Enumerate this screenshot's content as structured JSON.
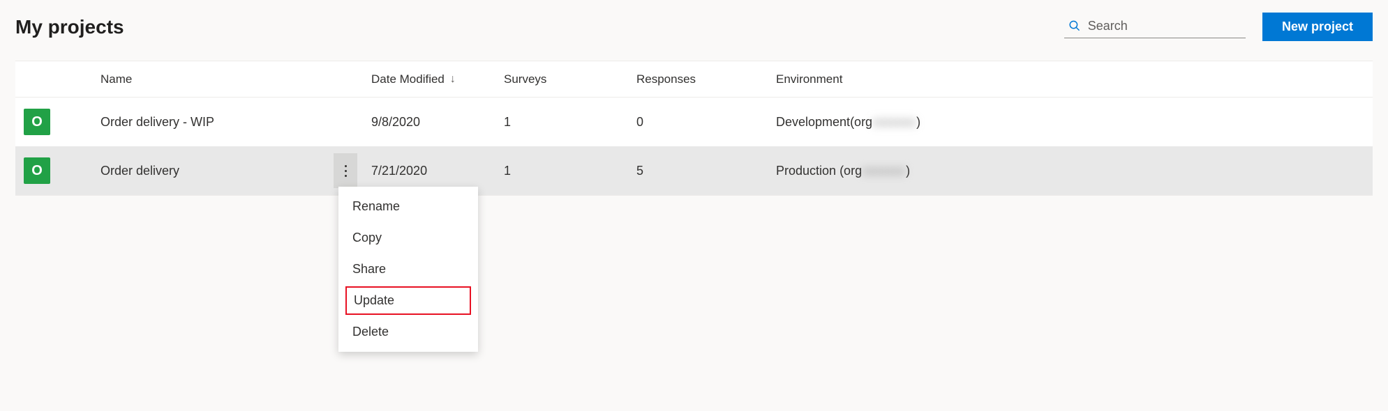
{
  "header": {
    "title": "My projects",
    "search_placeholder": "Search",
    "new_project_label": "New project"
  },
  "table": {
    "columns": {
      "name": "Name",
      "date_modified": "Date Modified",
      "surveys": "Surveys",
      "responses": "Responses",
      "environment": "Environment"
    },
    "sort_indicator": "↓",
    "rows": [
      {
        "badge": "O",
        "name": "Order delivery - WIP",
        "date_modified": "9/8/2020",
        "surveys": "1",
        "responses": "0",
        "environment": "Development",
        "org_prefix": "(org",
        "org_blur": "xxxxxxx",
        "org_suffix": ")",
        "selected": false
      },
      {
        "badge": "O",
        "name": "Order delivery",
        "date_modified": "7/21/2020",
        "surveys": "1",
        "responses": "5",
        "environment": "Production",
        "org_prefix": " (org",
        "org_blur": "xxxxxxx",
        "org_suffix": ")",
        "selected": true
      }
    ]
  },
  "context_menu": {
    "items": [
      {
        "label": "Rename",
        "highlighted": false
      },
      {
        "label": "Copy",
        "highlighted": false
      },
      {
        "label": "Share",
        "highlighted": false
      },
      {
        "label": "Update",
        "highlighted": true
      },
      {
        "label": "Delete",
        "highlighted": false
      }
    ]
  }
}
